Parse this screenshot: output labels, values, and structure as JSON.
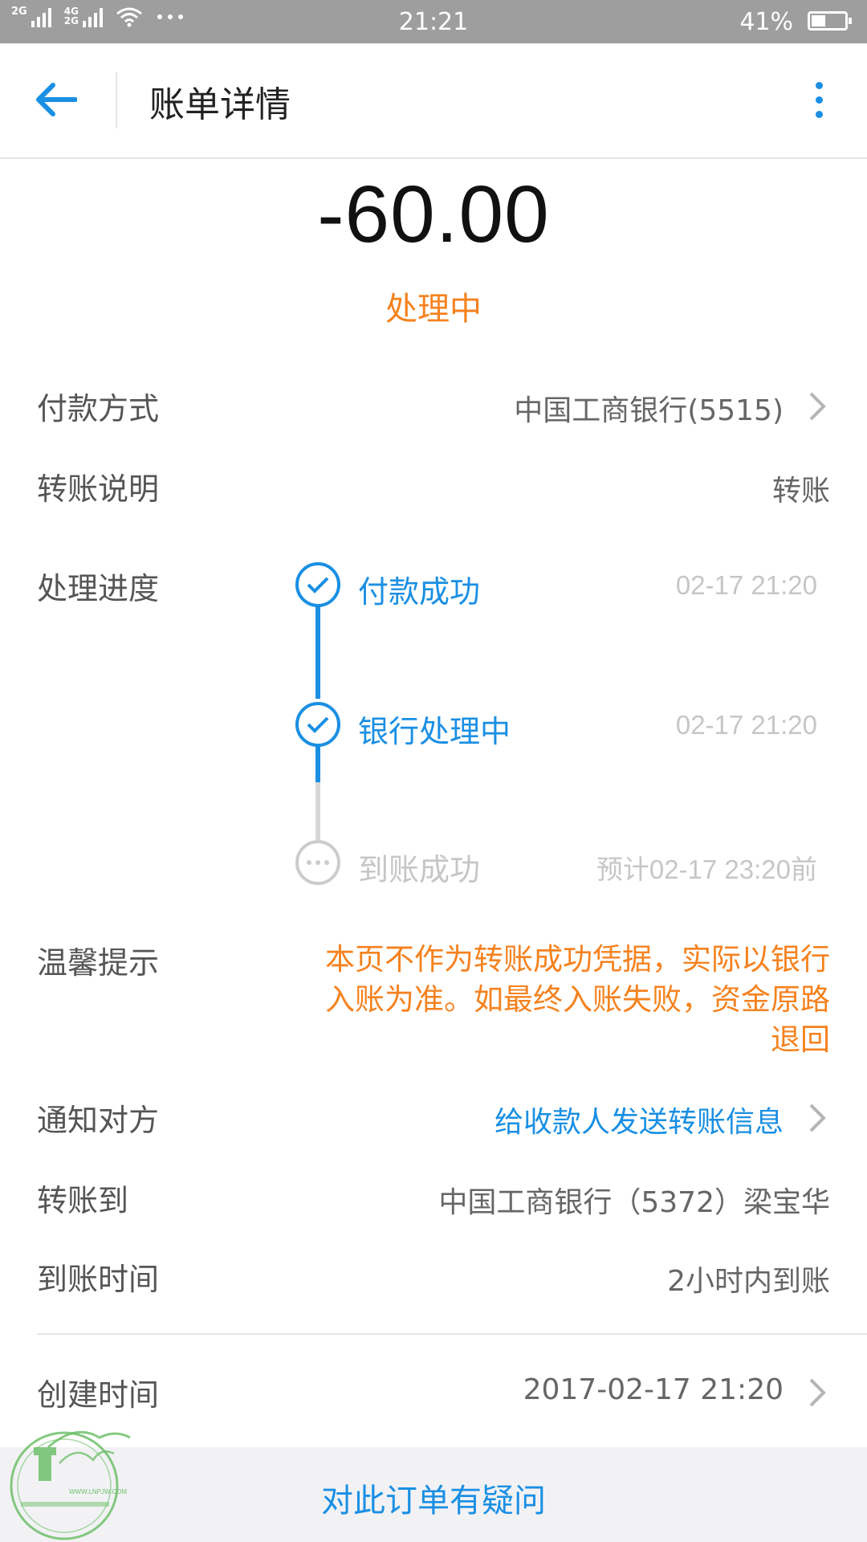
{
  "status_bar": {
    "signal1": "2G",
    "signal2_top": "4G",
    "signal2_bottom": "2G",
    "time": "21:21",
    "battery": "41%",
    "battery_level": 0.41
  },
  "header": {
    "title": "账单详情"
  },
  "amount": "-60.00",
  "status": "处理中",
  "payment": {
    "label": "付款方式",
    "value": "中国工商银行(5515)"
  },
  "note": {
    "label": "转账说明",
    "value": "转账"
  },
  "progress": {
    "label": "处理进度",
    "steps": [
      {
        "label": "付款成功",
        "time": "02-17 21:20",
        "state": "done"
      },
      {
        "label": "银行处理中",
        "time": "02-17 21:20",
        "state": "done"
      },
      {
        "label": "到账成功",
        "time": "预计02-17 23:20前",
        "state": "pending"
      }
    ]
  },
  "tip": {
    "label": "温馨提示",
    "line1": "本页不作为转账成功凭据，实际以银行",
    "line2": "入账为准。如最终入账失败，资金原路",
    "line3": "退回"
  },
  "notify": {
    "label": "通知对方",
    "value": "给收款人发送转账信息"
  },
  "transfer_to": {
    "label": "转账到",
    "value": "中国工商银行（5372）梁宝华"
  },
  "arrival_time": {
    "label": "到账时间",
    "value": "2小时内到账"
  },
  "created": {
    "label": "创建时间",
    "value": "2017-02-17 21:20"
  },
  "bottom": {
    "question": "对此订单有疑问"
  },
  "watermark": {
    "url": "WWW.LNPJW.COM"
  },
  "colors": {
    "accent": "#1a8fe3",
    "warning": "#f5821f"
  }
}
